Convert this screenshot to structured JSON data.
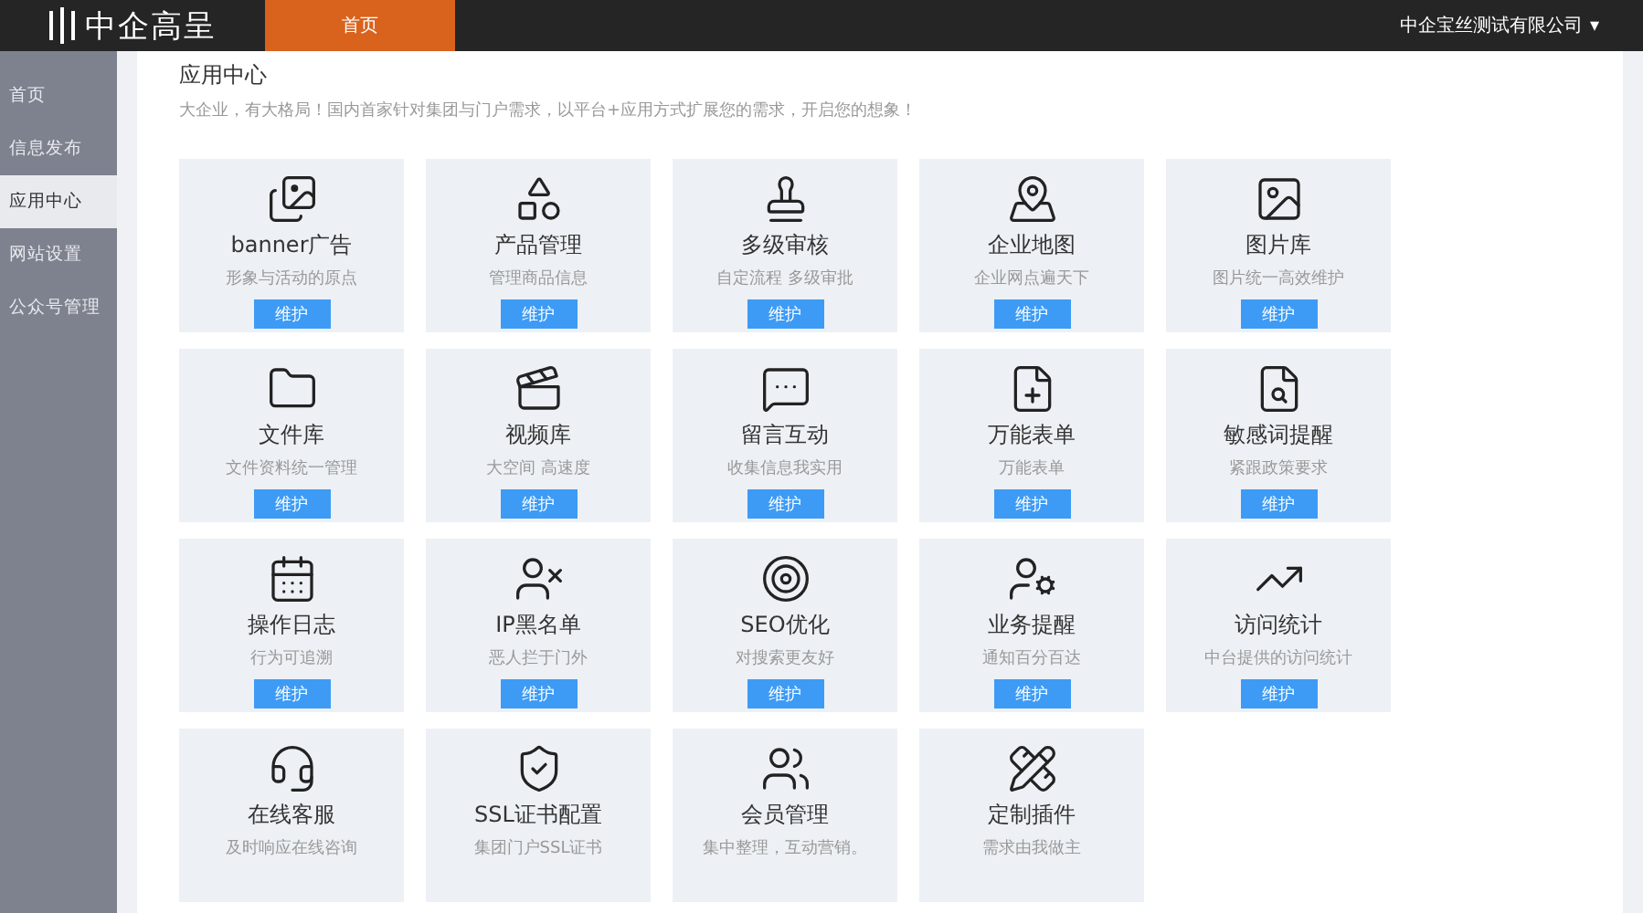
{
  "header": {
    "logo": "中企高呈",
    "nav": [
      {
        "label": "首页",
        "selected": true
      }
    ],
    "company": "中企宝丝测试有限公司",
    "caret": "▾"
  },
  "sidebar": {
    "items": [
      {
        "label": "首页",
        "selected": false
      },
      {
        "label": "信息发布",
        "selected": false
      },
      {
        "label": "应用中心",
        "selected": true
      },
      {
        "label": "网站设置",
        "selected": false
      },
      {
        "label": "公众号管理",
        "selected": false
      }
    ]
  },
  "page": {
    "title": "应用中心",
    "subtitle": "大企业，有大格局！国内首家针对集团与门户需求，以平台+应用方式扩展您的需求，开启您的想象！"
  },
  "apps": [
    {
      "name": "banner广告",
      "desc": "形象与活动的原点",
      "button": "维护"
    },
    {
      "name": "产品管理",
      "desc": "管理商品信息",
      "button": "维护"
    },
    {
      "name": "多级审核",
      "desc": "自定流程 多级审批",
      "button": "维护"
    },
    {
      "name": "企业地图",
      "desc": "企业网点遍天下",
      "button": "维护"
    },
    {
      "name": "图片库",
      "desc": "图片统一高效维护",
      "button": "维护"
    },
    {
      "name": "文件库",
      "desc": "文件资料统一管理",
      "button": "维护"
    },
    {
      "name": "视频库",
      "desc": "大空间 高速度",
      "button": "维护"
    },
    {
      "name": "留言互动",
      "desc": "收集信息我实用",
      "button": "维护"
    },
    {
      "name": "万能表单",
      "desc": "万能表单",
      "button": "维护"
    },
    {
      "name": "敏感词提醒",
      "desc": "紧跟政策要求",
      "button": "维护"
    },
    {
      "name": "操作日志",
      "desc": "行为可追溯",
      "button": "维护"
    },
    {
      "name": "IP黑名单",
      "desc": "恶人拦于门外",
      "button": "维护"
    },
    {
      "name": "SEO优化",
      "desc": "对搜索更友好",
      "button": "维护"
    },
    {
      "name": "业务提醒",
      "desc": "通知百分百达",
      "button": "维护"
    },
    {
      "name": "访问统计",
      "desc": "中台提供的访问统计",
      "button": "维护"
    },
    {
      "name": "在线客服",
      "desc": "及时响应在线咨询"
    },
    {
      "name": "SSL证书配置",
      "desc": "集团门户SSL证书"
    },
    {
      "name": "会员管理",
      "desc": "集中整理，互动营销。"
    },
    {
      "name": "定制插件",
      "desc": "需求由我做主"
    }
  ]
}
